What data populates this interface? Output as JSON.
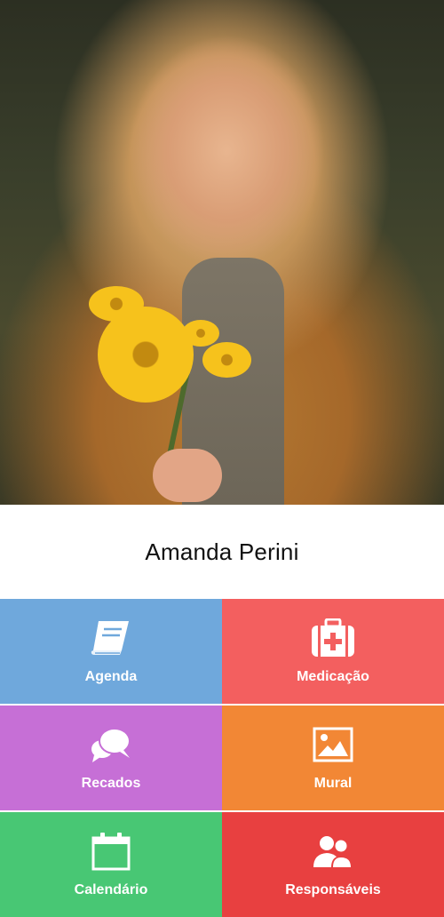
{
  "profile": {
    "name": "Amanda Perini"
  },
  "menu": [
    {
      "label": "Agenda",
      "icon": "book-icon",
      "color": "#6fa8dc"
    },
    {
      "label": "Medicação",
      "icon": "first-aid-kit-icon",
      "color": "#f35f5f"
    },
    {
      "label": "Recados",
      "icon": "chat-bubbles-icon",
      "color": "#c66fd6"
    },
    {
      "label": "Mural",
      "icon": "picture-icon",
      "color": "#f28735"
    },
    {
      "label": "Calendário",
      "icon": "calendar-icon",
      "color": "#48c774"
    },
    {
      "label": "Responsáveis",
      "icon": "users-icon",
      "color": "#e84040"
    }
  ]
}
